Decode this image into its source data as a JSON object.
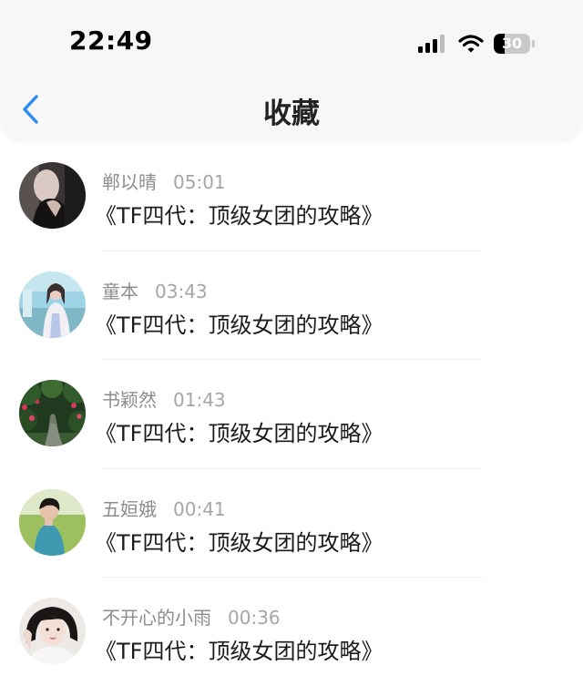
{
  "status_bar": {
    "time": "22:49",
    "battery_level": "30",
    "battery_fraction": 0.3
  },
  "nav": {
    "title": "收藏",
    "back_icon": "chevron-left-icon",
    "accent_color": "#2a8df0"
  },
  "favorites": [
    {
      "user": "郸以晴",
      "time": "05:01",
      "title": "《TF四代：顶级女团的攻略》",
      "avatar": "dark-portrait"
    },
    {
      "user": "童本",
      "time": "03:43",
      "title": "《TF四代：顶级女团的攻略》",
      "avatar": "girl-outdoor"
    },
    {
      "user": "书颖然",
      "time": "01:43",
      "title": "《TF四代：顶级女团的攻略》",
      "avatar": "garden-path"
    },
    {
      "user": "五姮娥",
      "time": "00:41",
      "title": "《TF四代：顶级女团的攻略》",
      "avatar": "boy-field"
    },
    {
      "user": "不开心的小雨",
      "time": "00:36",
      "title": "《TF四代：顶级女团的攻略》",
      "avatar": "girl-portrait"
    }
  ]
}
